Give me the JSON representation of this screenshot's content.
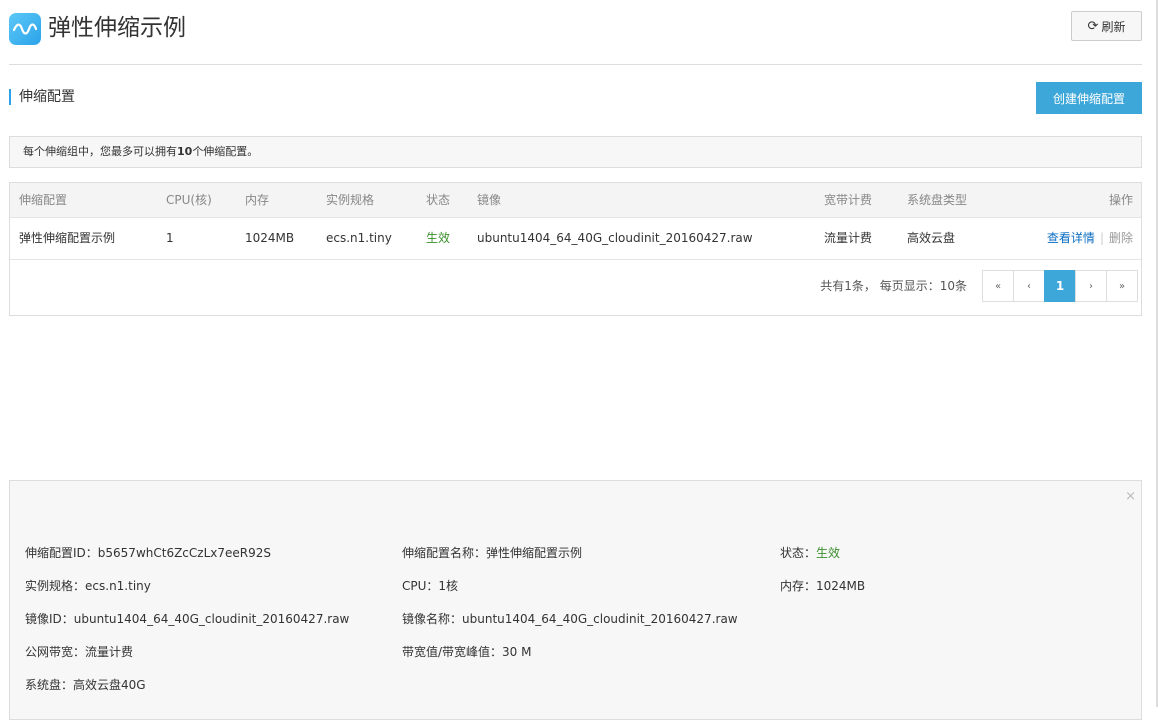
{
  "header": {
    "title": "弹性伸缩示例",
    "refresh_label": "刷新"
  },
  "section": {
    "title": "伸缩配置",
    "create_label": "创建伸缩配置"
  },
  "notice": {
    "prefix": "每个伸缩组中，您最多可以拥有",
    "count": "10",
    "suffix": "个伸缩配置。"
  },
  "table": {
    "columns": [
      "伸缩配置",
      "CPU(核)",
      "内存",
      "实例规格",
      "状态",
      "镜像",
      "宽带计费",
      "系统盘类型",
      "操作"
    ],
    "rows": [
      {
        "name": "弹性伸缩配置示例",
        "cpu": "1",
        "memory": "1024MB",
        "spec": "ecs.n1.tiny",
        "status": "生效",
        "image": "ubuntu1404_64_40G_cloudinit_20160427.raw",
        "billing": "流量计费",
        "disk": "高效云盘",
        "action_view": "查看详情",
        "action_delete": "删除"
      }
    ],
    "pager_info": "共有1条， 每页显示：10条",
    "pager": [
      "«",
      "‹",
      "1",
      "›",
      "»"
    ]
  },
  "detail": {
    "close": "×",
    "config_id_label": "伸缩配置ID：",
    "config_id": "b5657whCt6ZcCzLx7eeR92S",
    "config_name_label": "伸缩配置名称：",
    "config_name": "弹性伸缩配置示例",
    "status_label": "状态：",
    "status": "生效",
    "spec_label": "实例规格：",
    "spec": "ecs.n1.tiny",
    "cpu_label": "CPU：",
    "cpu": "1核",
    "memory_label": "内存：",
    "memory": "1024MB",
    "image_id_label": "镜像ID：",
    "image_id": "ubuntu1404_64_40G_cloudinit_20160427.raw",
    "image_name_label": "镜像名称：",
    "image_name": "ubuntu1404_64_40G_cloudinit_20160427.raw",
    "bandwidth_label": "公网带宽：",
    "bandwidth": "流量计费",
    "peak_label": "带宽值/带宽峰值：",
    "peak": "30 M",
    "disk_label": "系统盘：",
    "disk": "高效云盘40G"
  },
  "colors": {
    "accent": "#3ea7d9",
    "status_ok": "#3b8f2c",
    "link": "#0e6ec2"
  }
}
